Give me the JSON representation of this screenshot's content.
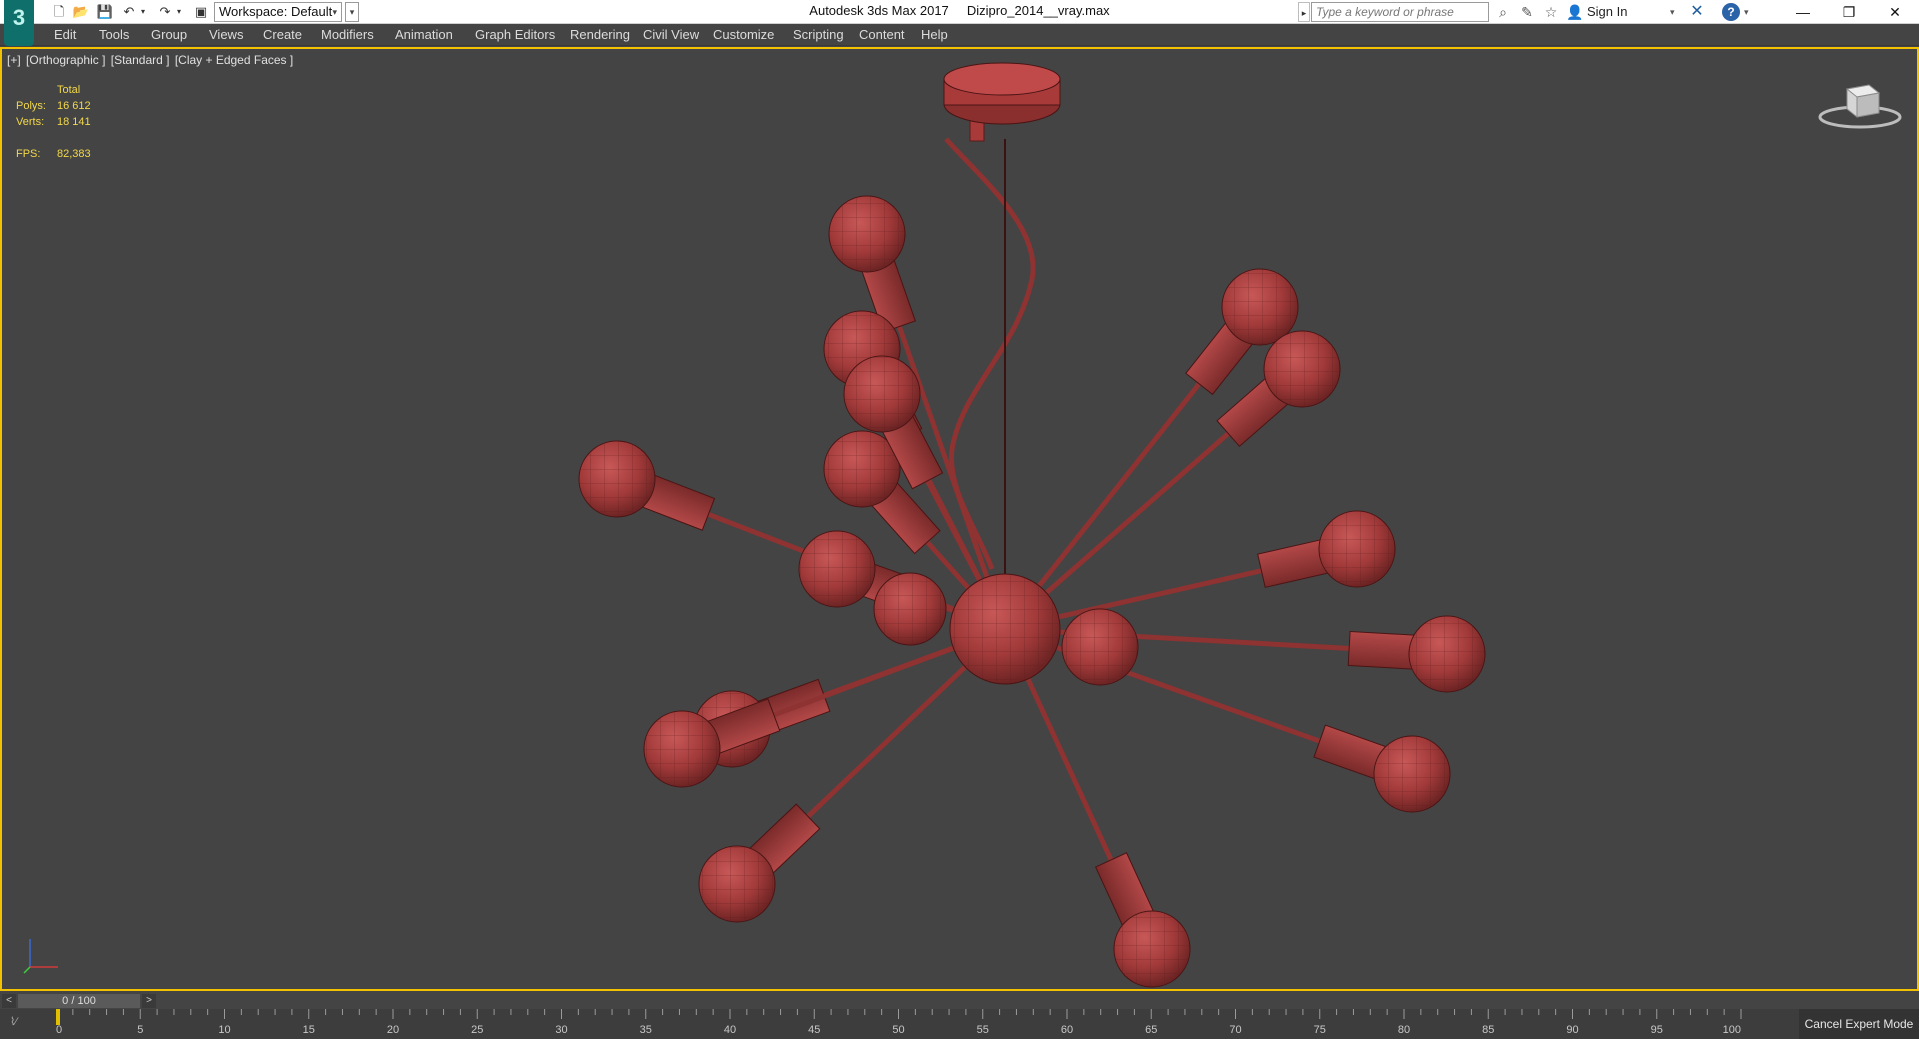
{
  "app": {
    "logo_text": "3",
    "window_title": "Autodesk 3ds Max 2017",
    "file_name": "Dizipro_2014__vray.max"
  },
  "quick_access": {
    "workspace_label": "Workspace: Default",
    "icons": [
      "new-file-icon",
      "open-file-icon",
      "save-icon",
      "undo-icon",
      "redo-icon",
      "project-icon"
    ]
  },
  "search": {
    "placeholder": "Type a keyword or phrase"
  },
  "account": {
    "sign_in_label": "Sign In"
  },
  "menu": {
    "items": [
      "Edit",
      "Tools",
      "Group",
      "Views",
      "Create",
      "Modifiers",
      "Animation",
      "Graph Editors",
      "Rendering",
      "Civil View",
      "Customize",
      "Scripting",
      "Content",
      "Help"
    ]
  },
  "viewport": {
    "label_plus": "[+]",
    "label_view": "[Orthographic ]",
    "label_shading": "[Standard ]",
    "label_mode": "[Clay + Edged Faces ]",
    "stats": {
      "header": "Total",
      "polys_label": "Polys:",
      "polys_value": "16 612",
      "verts_label": "Verts:",
      "verts_value": "18 141",
      "fps_label": "FPS:",
      "fps_value": "82,383"
    },
    "model_color": "#a83a3a"
  },
  "timeline": {
    "frame_display": "0 / 100",
    "prev_label": "<",
    "next_label": ">",
    "ruler_ticks": [
      "0",
      "5",
      "10",
      "15",
      "20",
      "25",
      "30",
      "35",
      "40",
      "45",
      "50",
      "55",
      "60",
      "65",
      "70",
      "75",
      "80",
      "85",
      "90",
      "95",
      "100"
    ]
  },
  "status": {
    "cancel_expert_label": "Cancel Expert Mode"
  },
  "colors": {
    "viewport_bg": "#444444",
    "active_border": "#f2c200",
    "stats_text": "#f2d84a"
  }
}
